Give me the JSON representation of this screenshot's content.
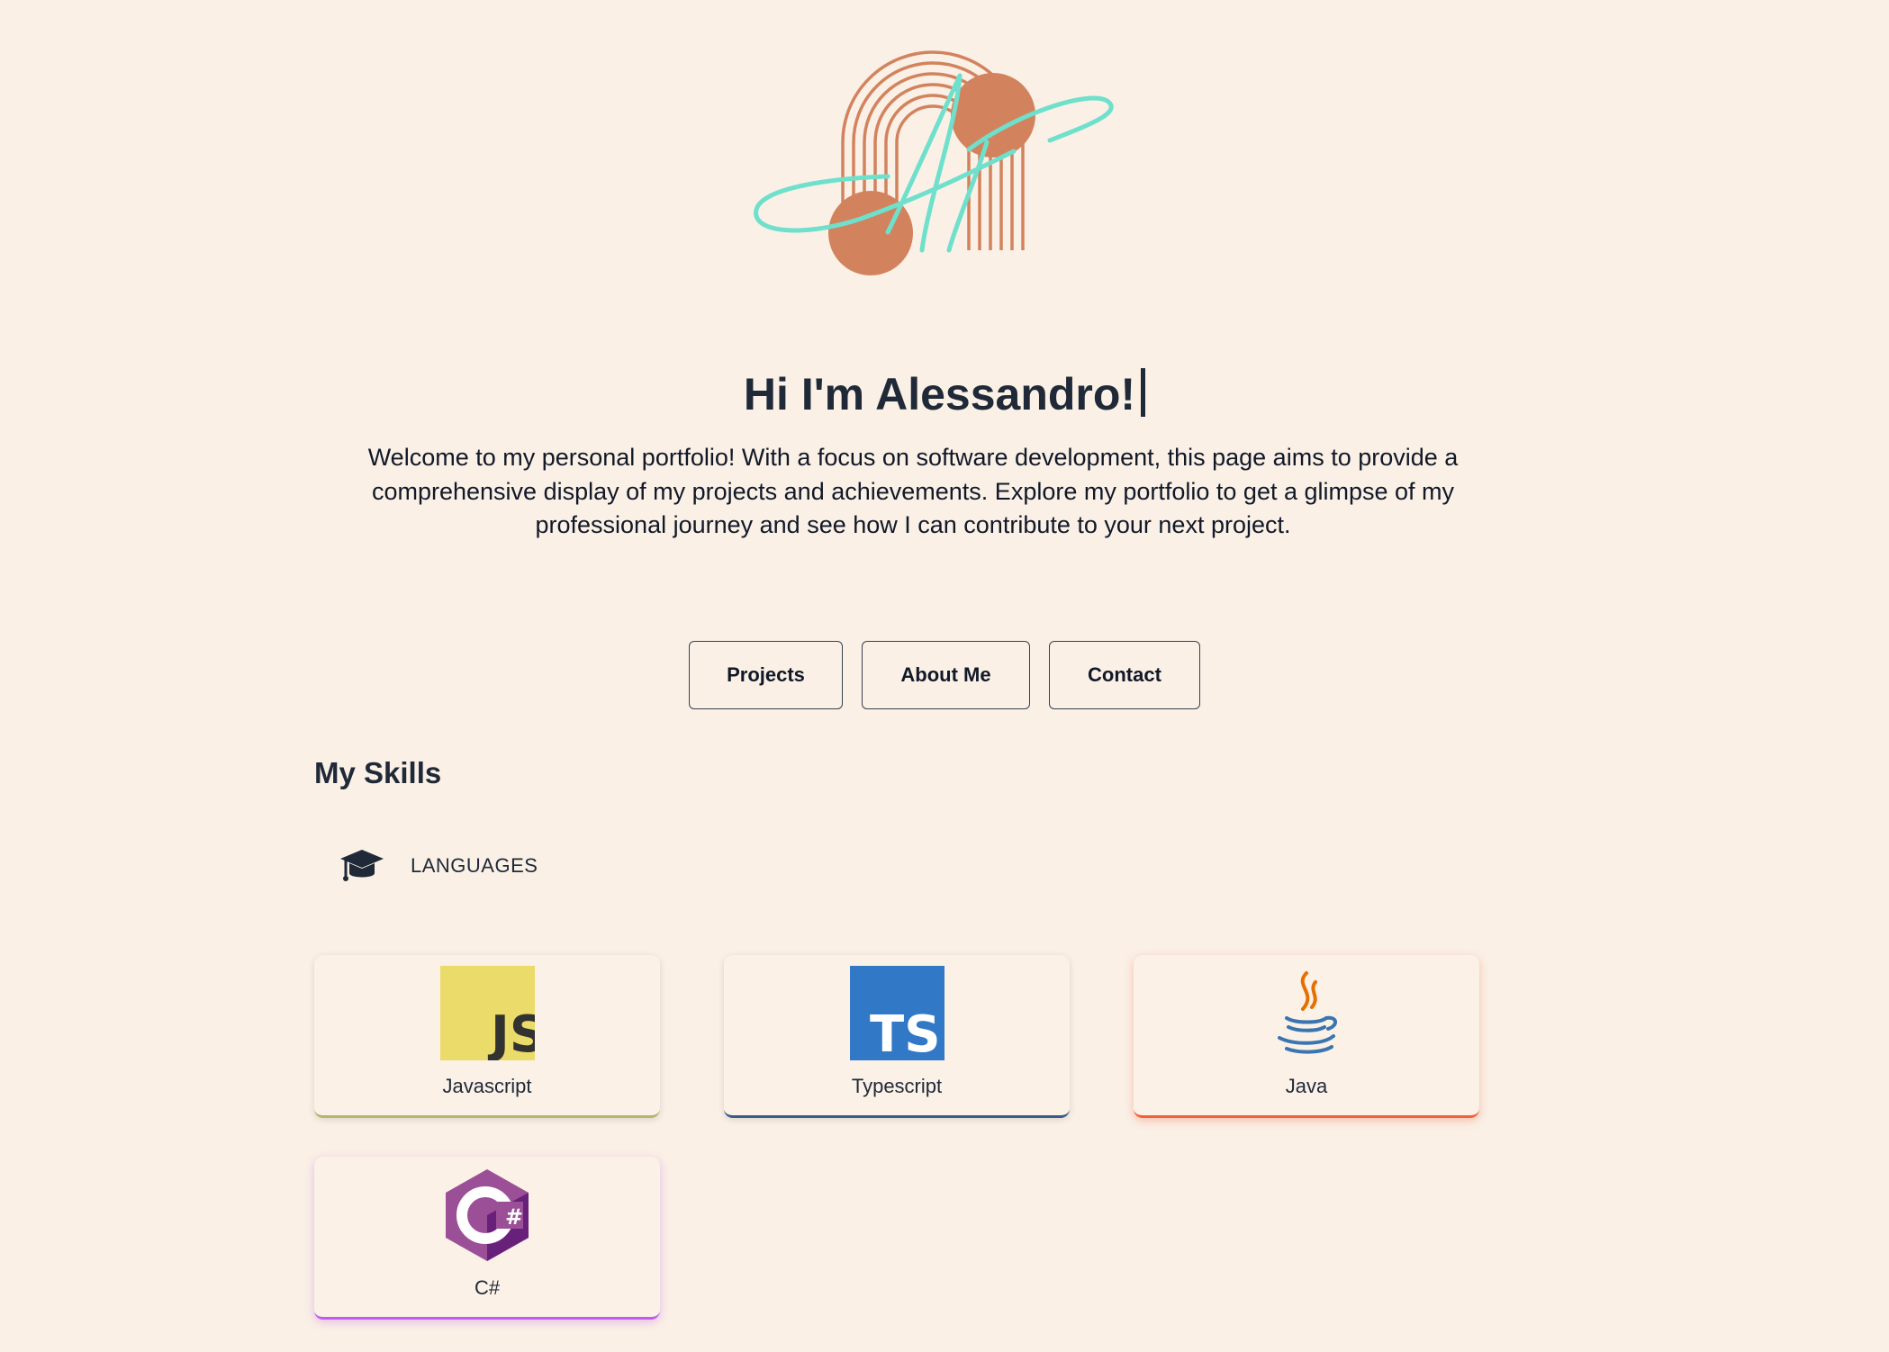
{
  "hero": {
    "title": "Hi I'm Alessandro!",
    "intro": "Welcome to my personal portfolio! With a focus on software development, this page aims to provide a comprehensive display of my projects and achievements. Explore my portfolio to get a glimpse of my professional journey and see how I can contribute to your next project."
  },
  "nav": {
    "projects_label": "Projects",
    "about_label": "About Me",
    "contact_label": "Contact"
  },
  "skills": {
    "title": "My Skills",
    "category": {
      "icon": "graduation-cap-icon",
      "label": "LANGUAGES"
    },
    "items": [
      {
        "label": "Javascript",
        "icon": "javascript-logo-icon",
        "accent": "#b9b36b",
        "logo_text": "JS"
      },
      {
        "label": "Typescript",
        "icon": "typescript-logo-icon",
        "accent": "#3b5b8c",
        "logo_text": "TS"
      },
      {
        "label": "Java",
        "icon": "java-logo-icon",
        "accent": "#f0623b"
      },
      {
        "label": "C#",
        "icon": "csharp-logo-icon",
        "accent": "#c15cf0"
      }
    ]
  },
  "colors": {
    "background": "#faf0e6",
    "logo_arch": "#d2835e",
    "logo_script": "#6ee0cc",
    "text": "#1f2937"
  }
}
